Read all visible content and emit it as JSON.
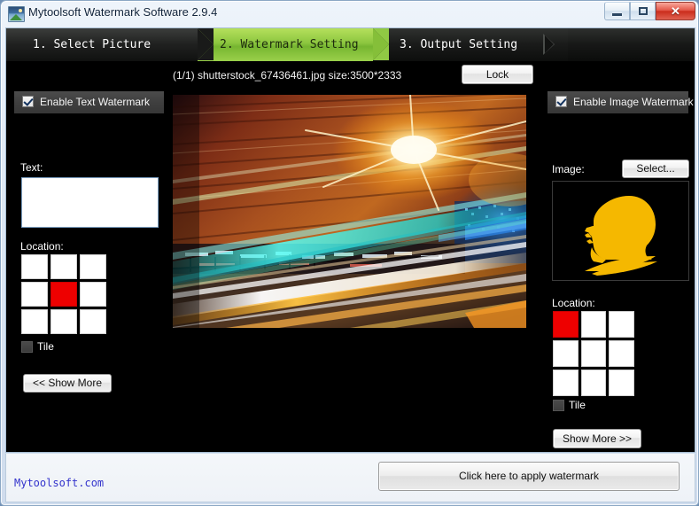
{
  "window": {
    "title": "Mytoolsoft Watermark Software 2.9.4",
    "icon": "picture-icon",
    "minimize_label": "",
    "maximize_label": "",
    "close_label": "✕"
  },
  "steps": [
    {
      "label": "1. Select Picture",
      "active": false
    },
    {
      "label": "2. Watermark Setting",
      "active": true
    },
    {
      "label": "3. Output Setting",
      "active": false
    }
  ],
  "file_info": {
    "text": "(1/1) shutterstock_67436461.jpg size:3500*2333",
    "index": "1/1",
    "filename": "shutterstock_67436461.jpg",
    "size": "3500*2333"
  },
  "lock_button": {
    "label": "Lock"
  },
  "text_watermark": {
    "enable_label": "Enable Text Watermark",
    "enabled": true,
    "text_label": "Text:",
    "text_value": "",
    "text_placeholder": "",
    "location_label": "Location:",
    "selected_cell": 4,
    "tile_label": "Tile",
    "tile_checked": false,
    "show_more_label": "<< Show More"
  },
  "image_watermark": {
    "enable_label": "Enable Image Watermark",
    "enabled": true,
    "image_label": "Image:",
    "select_label": "Select...",
    "preview_alt": "head-silhouette-watermark",
    "preview_color": "#f5b800",
    "preview_background": "#000000",
    "location_label": "Location:",
    "selected_cell": 0,
    "tile_label": "Tile",
    "tile_checked": false,
    "show_more_label": "Show More >>"
  },
  "preview": {
    "alt": "night-city-light-trails-photo"
  },
  "footer": {
    "link_label": "Mytoolsoft.com",
    "apply_label": "Click here to apply watermark"
  },
  "colors": {
    "accent_green": "#8cc63f",
    "selection_red": "#ee0000",
    "link_blue": "#3333cc",
    "panel_dark": "#3f3f3f",
    "client_black": "#000000"
  }
}
